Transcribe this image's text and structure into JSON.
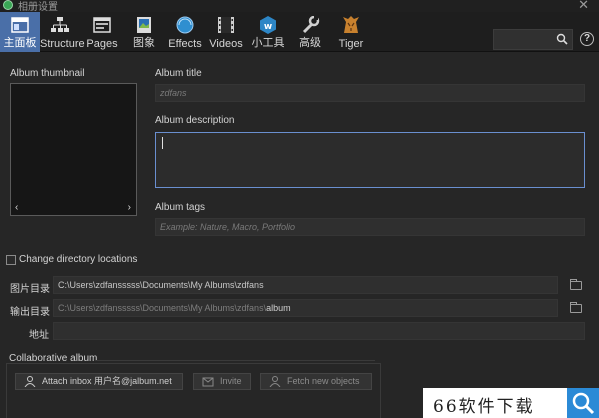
{
  "window": {
    "title": "相册设置"
  },
  "toolbar": {
    "items": [
      {
        "label": "主面板",
        "icon": "main-panel-icon"
      },
      {
        "label": "Structure",
        "icon": "structure-icon"
      },
      {
        "label": "Pages",
        "icon": "pages-icon"
      },
      {
        "label": "图象",
        "icon": "image-icon"
      },
      {
        "label": "Effects",
        "icon": "effects-icon"
      },
      {
        "label": "Videos",
        "icon": "videos-icon"
      },
      {
        "label": "小工具",
        "icon": "widgets-icon"
      },
      {
        "label": "高级",
        "icon": "advanced-icon"
      },
      {
        "label": "Tiger",
        "icon": "tiger-icon"
      }
    ],
    "search_value": "",
    "help_label": "?"
  },
  "album": {
    "thumbnail_label": "Album thumbnail",
    "thumb_prev": "‹",
    "thumb_next": "›",
    "title_label": "Album title",
    "title_placeholder": "zdfans",
    "description_label": "Album description",
    "description_value": "",
    "tags_label": "Album tags",
    "tags_placeholder": "Example: Nature, Macro, Portfolio"
  },
  "directories": {
    "change_label": "Change directory locations",
    "image_dir_label": "图片目录",
    "image_dir_value": "C:\\Users\\zdfansssss\\Documents\\My Albums\\zdfans",
    "output_dir_label": "输出目录",
    "output_dir_prefix": "C:\\Users\\zdfansssss\\Documents\\My Albums\\zdfans\\",
    "output_dir_suffix": "album",
    "address_label": "地址",
    "address_value": ""
  },
  "collab": {
    "label": "Collaborative album",
    "attach_button": "Attach inbox 用户名@jalbum.net",
    "invite_button": "Invite",
    "fetch_button": "Fetch new objects"
  },
  "watermark": {
    "text": "66软件下载"
  },
  "colors": {
    "active_tab": "#4a6fa8",
    "focus_border": "#6a8fd0",
    "watermark_blue": "#2b8ad6"
  }
}
